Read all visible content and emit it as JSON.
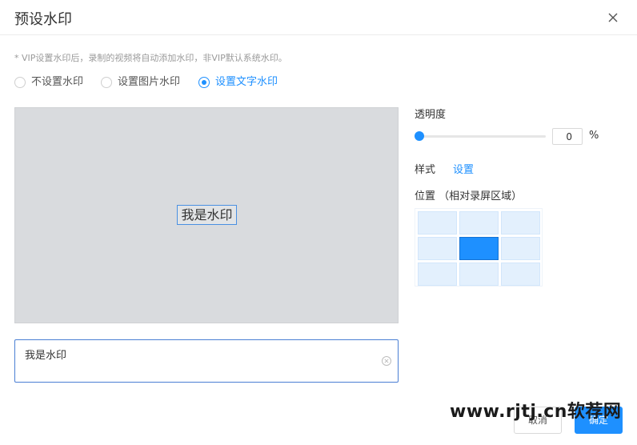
{
  "dialog": {
    "title": "预设水印",
    "notice": "* VIP设置水印后，录制的视频将自动添加水印，非VIP默认系统水印。"
  },
  "mode": {
    "options": [
      {
        "label": "不设置水印",
        "checked": false
      },
      {
        "label": "设置图片水印",
        "checked": false
      },
      {
        "label": "设置文字水印",
        "checked": true
      }
    ]
  },
  "preview": {
    "watermark_text": "我是水印"
  },
  "text_input": {
    "value": "我是水印"
  },
  "opacity": {
    "label": "透明度",
    "value": "0",
    "unit": "%"
  },
  "style": {
    "label": "样式",
    "link": "设置"
  },
  "position": {
    "label": "位置 （相对录屏区域）",
    "grid_rows": 3,
    "grid_cols": 3,
    "selected_row": 1,
    "selected_col": 1
  },
  "footer": {
    "cancel_label": "取消",
    "ok_label": "确定"
  },
  "overlay_watermark": "www.rjtj.cn软荐网",
  "colors": {
    "accent": "#1e90ff",
    "preview_bg": "#d9dbde",
    "cell_bg": "#e3f0fd"
  }
}
